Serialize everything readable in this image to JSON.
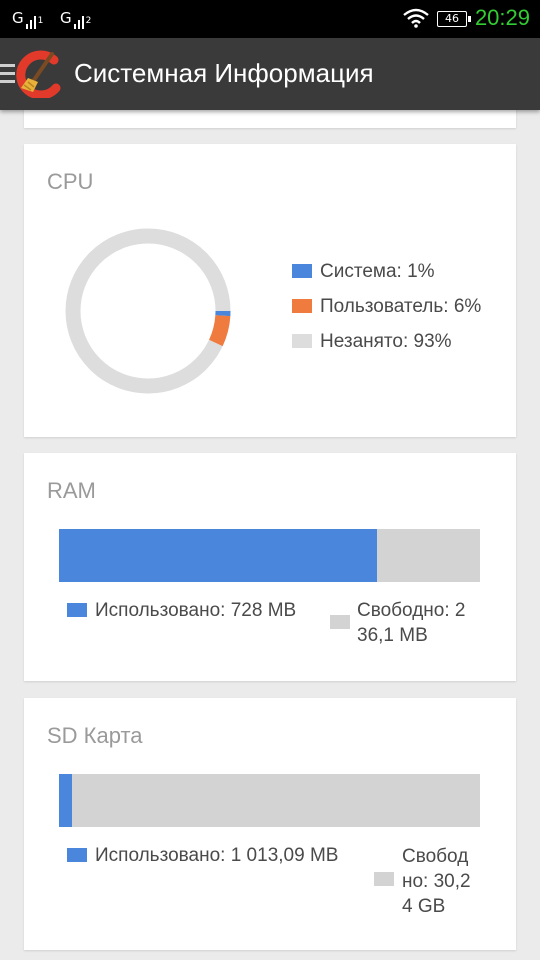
{
  "status_bar": {
    "sim1": "G",
    "sim1_sub": "1",
    "sim2": "G",
    "sim2_sub": "2",
    "battery": "46",
    "time": "20:29"
  },
  "action_bar": {
    "title": "Системная Информация",
    "icons": [
      "menu-icon",
      "ccleaner-logo"
    ]
  },
  "cpu": {
    "title": "CPU",
    "legend": [
      {
        "label": "Система: 1%",
        "color": "#4a86dc",
        "percent": 1
      },
      {
        "label": "Пользователь: 6%",
        "color": "#f07b3f",
        "percent": 6
      },
      {
        "label": "Незанято: 93%",
        "color": "#dddddd",
        "percent": 93
      }
    ]
  },
  "ram": {
    "title": "RAM",
    "used_fraction": 0.755,
    "used_label": "Использовано: 728 MB",
    "free_label_line1": "Свободно: 2",
    "free_label_line2": "36,1 MB"
  },
  "sd": {
    "title": "SD Карта",
    "used_fraction": 0.03,
    "used_label": "Использовано: 1 013,09 MB",
    "free_label_line1": "Свобод",
    "free_label_line2": "но: 30,2",
    "free_label_line3": "4 GB"
  },
  "colors": {
    "used": "#4a86dc",
    "user": "#f07b3f",
    "free": "#d3d3d3",
    "clock": "#33cc33"
  }
}
